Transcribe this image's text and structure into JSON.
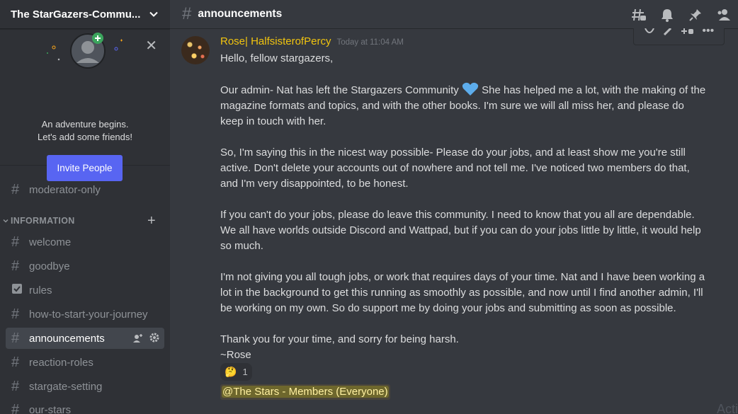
{
  "server": {
    "name": "The StarGazers-Commu..."
  },
  "invite": {
    "line1": "An adventure begins.",
    "line2": "Let's add some friends!",
    "button": "Invite People"
  },
  "channels": {
    "moderator_only": "moderator-only",
    "category": "INFORMATION",
    "welcome": "welcome",
    "goodbye": "goodbye",
    "rules": "rules",
    "how_to_start": "how-to-start-your-journey",
    "announcements": "announcements",
    "reaction_roles": "reaction-roles",
    "stargate_setting": "stargate-setting",
    "our_stars": "our-stars"
  },
  "topbar": {
    "channel": "announcements"
  },
  "message": {
    "author": "Rose| HalfsisterofPercy",
    "timestamp": "Today at 11:04 AM",
    "greeting": "Hello, fellow stargazers,",
    "p1a": "Our admin- Nat has left the Stargazers Community",
    "p1b": "She has helped me a lot, with the making of the magazine formats and topics, and with the other books. I'm sure we will all miss her, and please do keep in touch with her.",
    "p2": "So, I'm saying this in the nicest way possible- Please do your jobs, and at least show me you're still active. Don't delete your accounts out of nowhere and not tell me. I've noticed two members do that, and I'm very disappointed, to be honest.",
    "p3": "If you can't do your jobs, please do leave this community. I need to know that you all are dependable. We all have worlds outside Discord and Wattpad, but if you can do your jobs little by little, it would help so much.",
    "p4": "I'm not giving you all tough jobs, or work that requires days of your time. Nat and I have been working a lot in the background to get this running as smoothly as possible, and now until I find another admin, I'll be working on my own. So do support me by doing your jobs and submitting as soon as possible.",
    "p5a": "Thank you for your time, and sorry for being harsh.",
    "p5b": "~Rose",
    "reaction_emoji": "🤔",
    "reaction_count": "1",
    "mention": "@The Stars - Members (Everyone)"
  },
  "watermark": "Acti",
  "colors": {
    "accent": "#5865f2",
    "author": "#f1c40f",
    "mention": "#faa61a",
    "sidebar_bg": "#2f3136",
    "main_bg": "#36393f"
  }
}
